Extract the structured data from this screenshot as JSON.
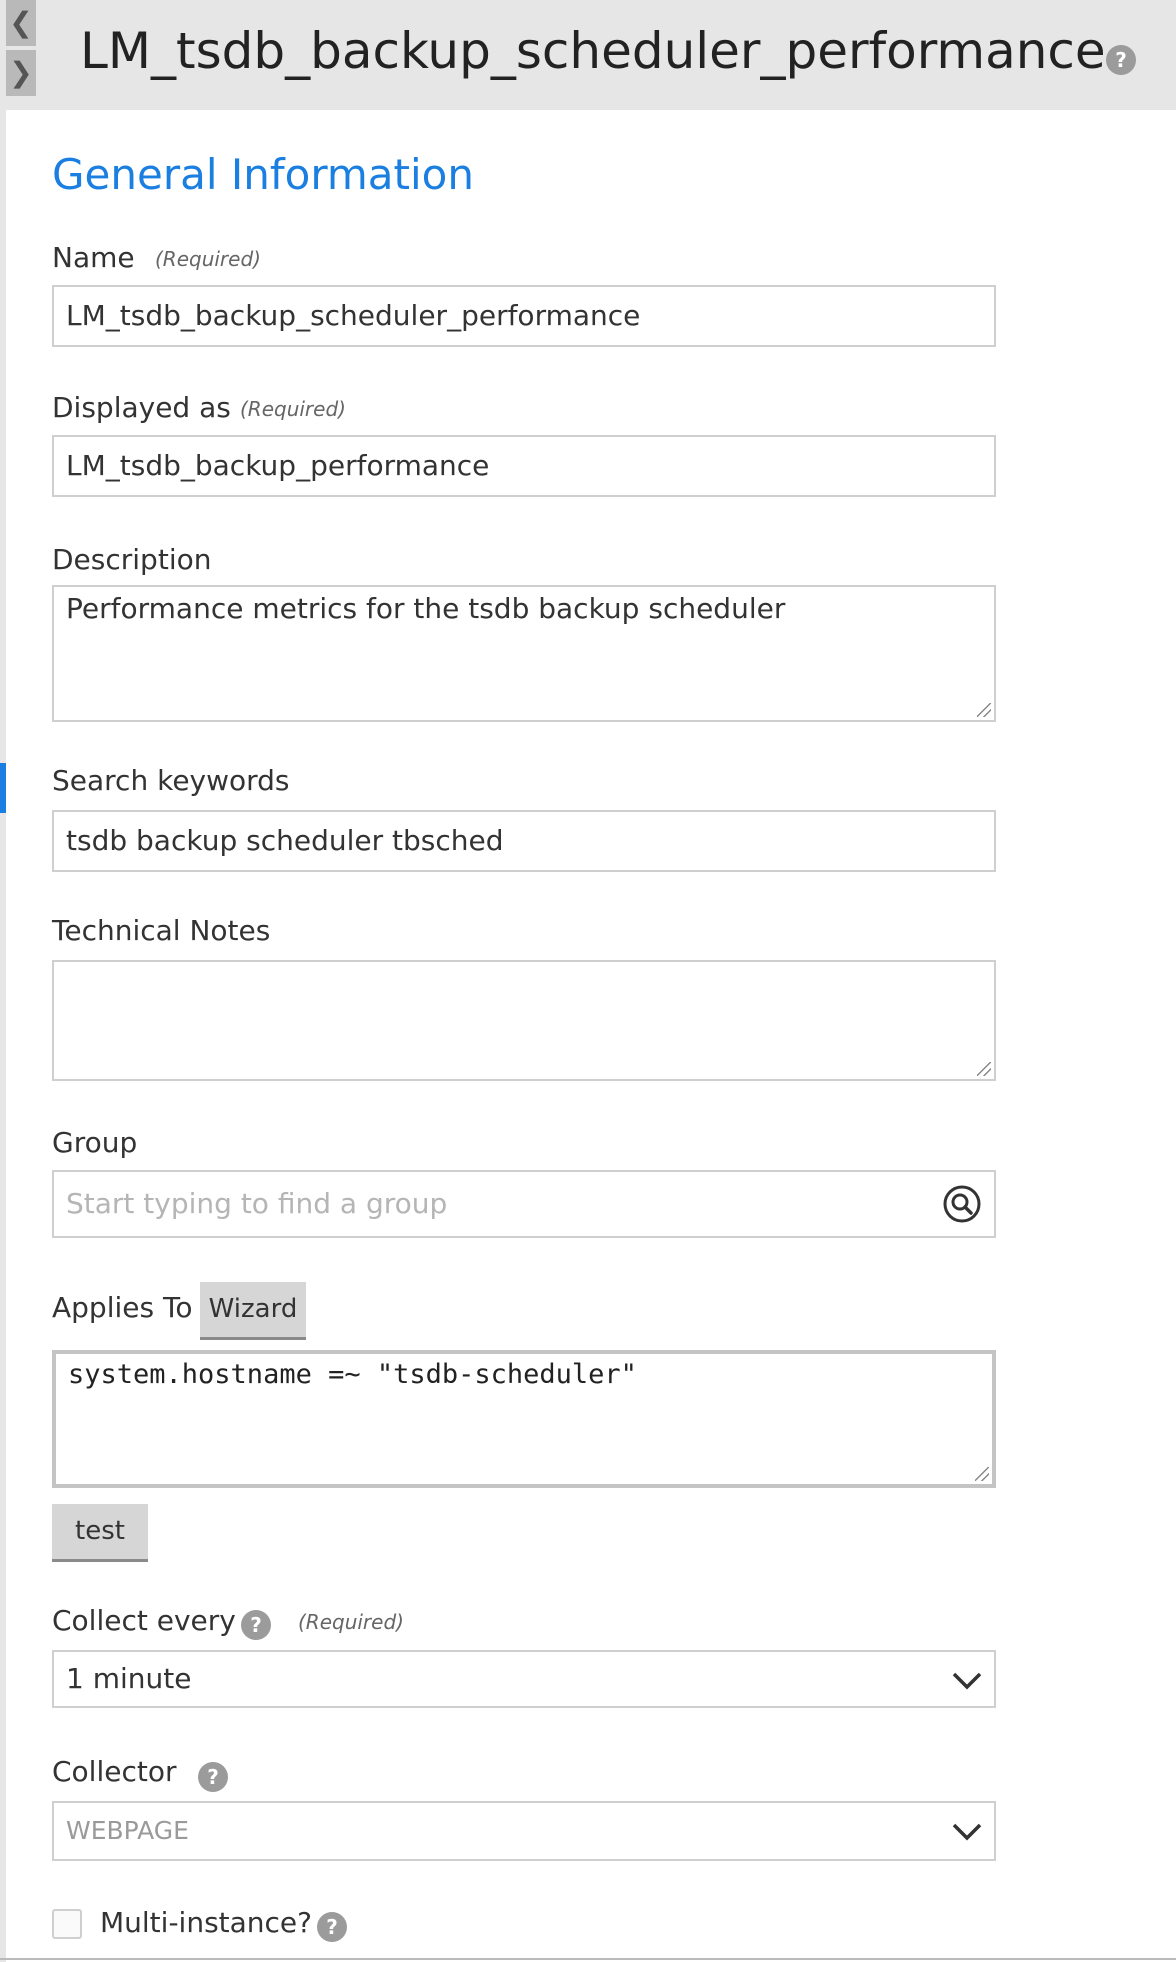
{
  "header": {
    "title": "LM_tsdb_backup_scheduler_performance",
    "help_glyph": "?"
  },
  "nav": {
    "prev_glyph": "❮",
    "next_glyph": "❯"
  },
  "section": {
    "title": "General Information"
  },
  "required_tag": "(Required)",
  "fields": {
    "name": {
      "label": "Name",
      "value": "LM_tsdb_backup_scheduler_performance"
    },
    "displayed_as": {
      "label": "Displayed as",
      "value": "LM_tsdb_backup_performance"
    },
    "description": {
      "label": "Description",
      "value": "Performance metrics for the tsdb backup scheduler"
    },
    "search_keywords": {
      "label": "Search keywords",
      "value": "tsdb backup scheduler tbsched"
    },
    "technical_notes": {
      "label": "Technical Notes",
      "value": ""
    },
    "group": {
      "label": "Group",
      "placeholder": "Start typing to find a group"
    },
    "applies_to": {
      "label": "Applies To",
      "wizard_label": "Wizard",
      "value": "system.hostname =~ \"tsdb-scheduler\"",
      "test_label": "test"
    },
    "collect_every": {
      "label": "Collect every",
      "value": "1 minute"
    },
    "collector": {
      "label": "Collector",
      "value": "WEBPAGE"
    },
    "multi_instance": {
      "label": "Multi-instance?",
      "checked": false
    }
  },
  "colors": {
    "accent": "#1a7fe0",
    "header_bg": "#e6e6e6",
    "help_bg": "#9b9b9b"
  }
}
